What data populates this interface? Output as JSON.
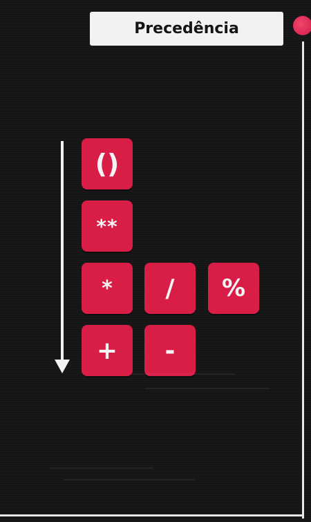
{
  "title": "Precedência",
  "accent_color": "#d81d47",
  "indicator_color": "#e0264f",
  "arrow": {
    "direction": "down",
    "meaning": "order"
  },
  "operators": {
    "row1": [
      "()"
    ],
    "row2": [
      "**"
    ],
    "row3": [
      "*",
      "/",
      "%"
    ],
    "row4": [
      "+",
      "-"
    ]
  }
}
